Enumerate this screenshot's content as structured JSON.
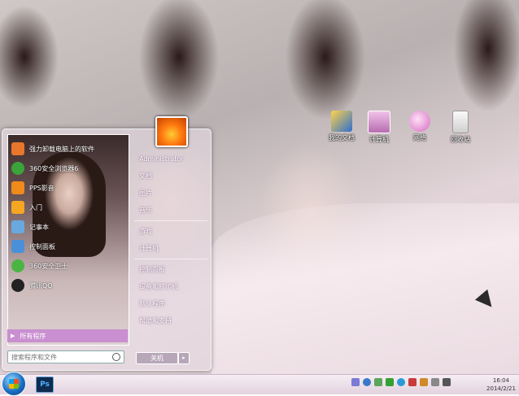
{
  "desktop": {
    "icons": [
      {
        "label": "我的文档",
        "color": "#2f6fcf"
      },
      {
        "label": "计算机",
        "color": "#d88ad0"
      },
      {
        "label": "网络",
        "color": "#e07ad0"
      },
      {
        "label": "回收站",
        "color": "#e9e9e9"
      }
    ]
  },
  "start_menu": {
    "programs": [
      {
        "label": "强力卸载电脑上的软件",
        "color": "#e8762b"
      },
      {
        "label": "360安全浏览器6",
        "color": "#3aa43a"
      },
      {
        "label": "PPS影音",
        "color": "#f08a1a"
      },
      {
        "label": "入门",
        "color": "#f5a623"
      },
      {
        "label": "记事本",
        "color": "#68a9e0"
      },
      {
        "label": "控制面板",
        "color": "#4a90d9"
      },
      {
        "label": "360安全卫士",
        "color": "#4bb543"
      },
      {
        "label": "腾讯QQ",
        "color": "#222222"
      }
    ],
    "all_programs": "所有程序",
    "search_placeholder": "搜索程序和文件",
    "right_items": [
      {
        "label": "Administrator",
        "arrow": false
      },
      {
        "label": "文档",
        "arrow": false
      },
      {
        "label": "图片",
        "arrow": false
      },
      {
        "label": "音乐",
        "arrow": false
      },
      {
        "label": "游戏",
        "arrow": false
      },
      {
        "label": "计算机",
        "arrow": false
      },
      {
        "label": "控制面板",
        "arrow": false
      },
      {
        "label": "设备和打印机",
        "arrow": false
      },
      {
        "label": "默认程序",
        "arrow": false
      },
      {
        "label": "帮助和支持",
        "arrow": false
      }
    ],
    "shutdown_label": "关机",
    "shutdown_arrow": "▸"
  },
  "taskbar": {
    "pinned_app": "Ps",
    "clock_time": "16:04",
    "clock_date": "2014/2/21",
    "tray_colors": [
      "#7b7bd6",
      "#3a78c9",
      "#5aa65a",
      "#33a033",
      "#2a9ad6",
      "#c83b3b",
      "#d08a2a",
      "#888888",
      "#555555"
    ]
  },
  "colors": {
    "accent": "#c98fd0",
    "taskbar_bg": "#eee2eb"
  }
}
